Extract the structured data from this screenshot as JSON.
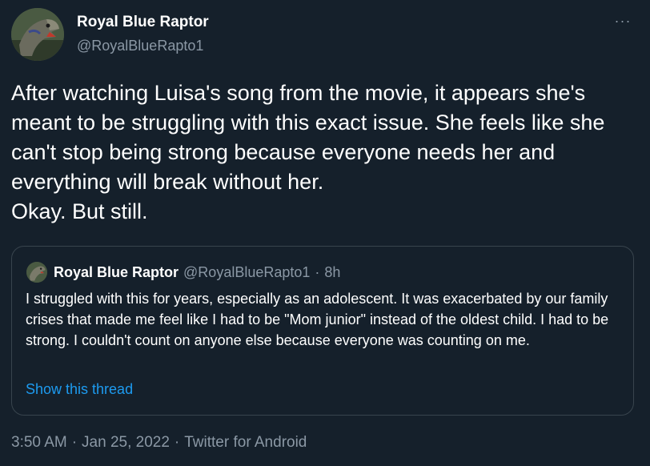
{
  "author": {
    "name": "Royal Blue Raptor",
    "handle": "@RoyalBlueRapto1",
    "avatar_icon": "raptor-avatar-icon"
  },
  "more_icon": "more-horizontal-icon",
  "more_glyph": "···",
  "tweet_text": "After watching Luisa's song from the movie, it appears she's meant to be struggling with this exact issue. She feels like she can't stop being strong because everyone needs her and everything will break without her.\nOkay. But still.",
  "quoted": {
    "name": "Royal Blue Raptor",
    "handle": "@RoyalBlueRapto1",
    "dot": "·",
    "time": "8h",
    "text": "I struggled with this for years, especially as an adolescent. It was exacerbated by our family crises that made me feel like I had to be \"Mom junior\" instead of the oldest child. I had to be strong. I couldn't count on anyone else because everyone was counting on me.",
    "show_thread": "Show this thread"
  },
  "meta": {
    "time": "3:50 AM",
    "dot1": "·",
    "date": "Jan 25, 2022",
    "dot2": "·",
    "source": "Twitter for Android"
  },
  "colors": {
    "background": "#15202b",
    "text": "#ffffff",
    "secondary": "#8b98a5",
    "link": "#1d9bf0",
    "border": "#38444d"
  }
}
